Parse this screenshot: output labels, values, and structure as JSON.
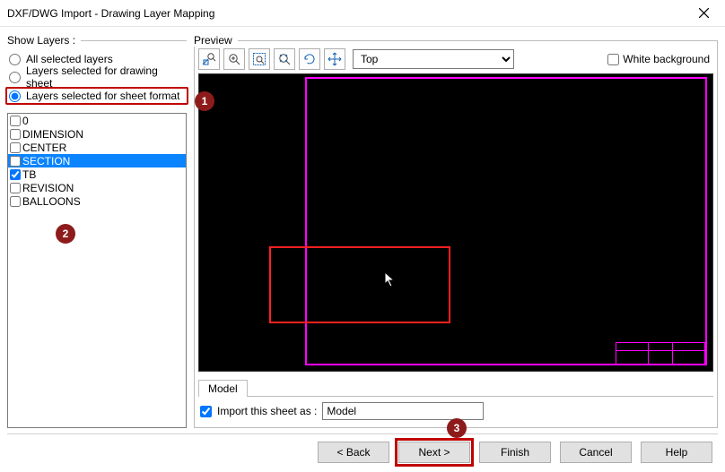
{
  "window": {
    "title": "DXF/DWG Import - Drawing Layer Mapping"
  },
  "left": {
    "group_label": "Show Layers :",
    "radio1": "All selected layers",
    "radio2": "Layers selected for drawing sheet",
    "radio3": "Layers selected for sheet format",
    "layers": [
      {
        "label": "0",
        "checked": false,
        "selected": false
      },
      {
        "label": "DIMENSION",
        "checked": false,
        "selected": false
      },
      {
        "label": "CENTER",
        "checked": false,
        "selected": false
      },
      {
        "label": "SECTION",
        "checked": false,
        "selected": true
      },
      {
        "label": "TB",
        "checked": true,
        "selected": false
      },
      {
        "label": "REVISION",
        "checked": false,
        "selected": false
      },
      {
        "label": "BALLOONS",
        "checked": false,
        "selected": false
      }
    ]
  },
  "preview": {
    "group_label": "Preview",
    "view_options": [
      "Top"
    ],
    "view_selected": "Top",
    "white_bg_label": "White background",
    "white_bg_checked": false,
    "tab_label": "Model",
    "import_label": "Import this sheet as :",
    "import_value": "Model",
    "import_checked": true
  },
  "buttons": {
    "back": "< Back",
    "next": "Next >",
    "finish": "Finish",
    "cancel": "Cancel",
    "help": "Help"
  },
  "callouts": {
    "c1": "1",
    "c2": "2",
    "c3": "3"
  },
  "icons": {
    "zoom_selection": "zoom-selection-icon",
    "zoom_in": "zoom-in-icon",
    "zoom_out": "zoom-out-icon",
    "zoom_fit": "zoom-fit-icon",
    "rotate": "rotate-icon",
    "pan": "pan-icon"
  },
  "colors": {
    "accent_red": "#C00000",
    "badge": "#8e1b1b",
    "selection": "#0a84ff",
    "canvas_magenta": "#ff00ff",
    "canvas_red": "#ff2020"
  }
}
